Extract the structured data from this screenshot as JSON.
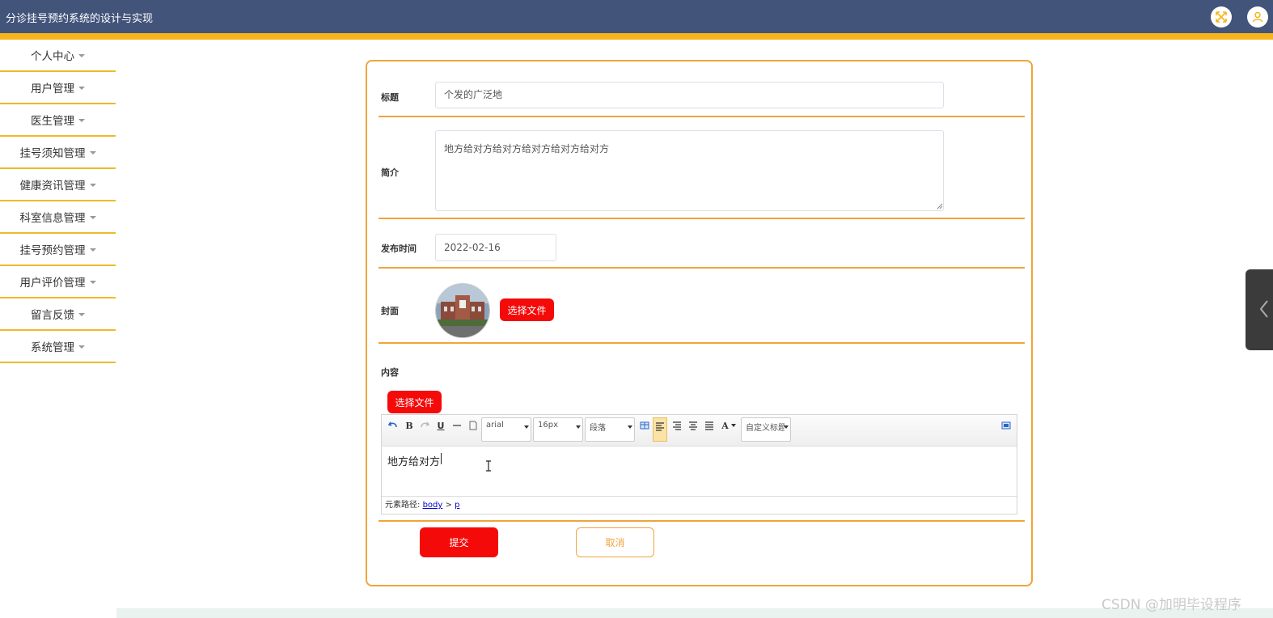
{
  "header": {
    "title": "分诊挂号预约系统的设计与实现"
  },
  "sidebar": {
    "items": [
      {
        "label": "个人中心"
      },
      {
        "label": "用户管理"
      },
      {
        "label": "医生管理"
      },
      {
        "label": "挂号须知管理"
      },
      {
        "label": "健康资讯管理"
      },
      {
        "label": "科室信息管理"
      },
      {
        "label": "挂号预约管理"
      },
      {
        "label": "用户评价管理"
      },
      {
        "label": "留言反馈"
      },
      {
        "label": "系统管理"
      }
    ]
  },
  "form": {
    "title_label": "标题",
    "title_value": "个发的广泛地",
    "intro_label": "简介",
    "intro_value": "地方给对方给对方给对方给对方给对方",
    "date_label": "发布时间",
    "date_value": "2022-02-16",
    "cover_label": "封面",
    "cover_button": "选择文件",
    "content_label": "内容",
    "content_button": "选择文件",
    "submit_button": "提交",
    "cancel_button": "取消"
  },
  "editor": {
    "font_family": "arial",
    "font_size": "16px",
    "paragraph": "段落",
    "custom_title": "自定义标题",
    "body_text": "地方给对方",
    "path_label": "元素路径:",
    "path_body": "body",
    "path_sep": ">",
    "path_p": "p"
  },
  "watermark": "CSDN @加明毕设程序",
  "colors": {
    "header": "#43547a",
    "accent": "#f6b51c",
    "primary_button": "#f50a0a",
    "card_border": "#f0a43c"
  }
}
